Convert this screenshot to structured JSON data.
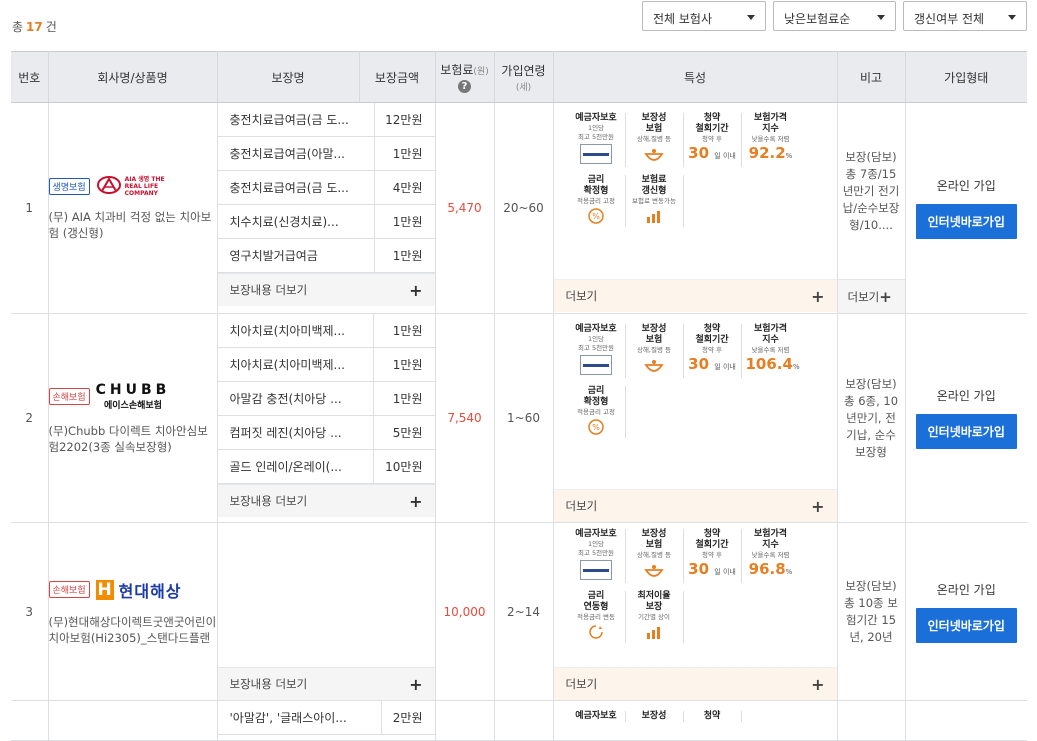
{
  "summary": {
    "prefix": "총",
    "count": "17",
    "suffix": "건"
  },
  "filters": [
    {
      "value": "전체 보험사"
    },
    {
      "value": "낮은보험료순"
    },
    {
      "value": "갱신여부 전체"
    }
  ],
  "headers": {
    "no": "번호",
    "company": "회사명/상품명",
    "coverage": "보장명",
    "amount": "보장금액",
    "premium": "보험료",
    "premium_unit": "(원)",
    "age": "가입연령",
    "age_unit": "(세)",
    "feature": "특성",
    "remark": "비고",
    "join": "가입형태"
  },
  "labels": {
    "coverage_more": "보장내용 더보기",
    "feature_more": "더보기",
    "remark_more": "더보기",
    "join_button": "인터넷바로가입",
    "help": "?"
  },
  "products": [
    {
      "no": "1",
      "type": "생명보험",
      "logo": "AIA 생명 THE REAL LIFE COMPANY",
      "name": "(무) AIA 치과비 걱정 없는 치아보험 (갱신형)",
      "coverages": [
        {
          "name": "충전치료급여금(금 도...",
          "amount": "12만원"
        },
        {
          "name": "충전치료급여금(아말...",
          "amount": "1만원"
        },
        {
          "name": "충전치료급여금(금 도...",
          "amount": "4만원"
        },
        {
          "name": "치수치료(신경치료)...",
          "amount": "1만원"
        },
        {
          "name": "영구치발거급여금",
          "amount": "1만원"
        }
      ],
      "premium": "5,470",
      "age": "20~60",
      "features": [
        {
          "t": "예금자보호",
          "s1": "1인당",
          "s2": "최고 5천만원",
          "icon": "seal"
        },
        {
          "t": "보장성\n보험",
          "s1": "상해,질병 등",
          "icon": "bowl"
        },
        {
          "t": "청약\n철회기간",
          "s1": "청약 후",
          "big": "30",
          "unit": "일 이내"
        },
        {
          "t": "보험가격\n지수",
          "s1": "낮을수록 저렴",
          "big": "92.2",
          "unit": "%"
        },
        {
          "t": "금리\n확정형",
          "s1": "적용금리 고정",
          "icon": "pct"
        },
        {
          "t": "보험료\n갱신형",
          "s1": "보험료 변동가능",
          "icon": "chart"
        }
      ],
      "remark": "보장(담보) 총 7종/15년만기 전기납/순수보장형/10....",
      "remark_more": true,
      "join_type": "온라인 가입"
    },
    {
      "no": "2",
      "type": "손해보험",
      "logo_big": "CHUBB",
      "logo_small": "에이스손해보험",
      "name": "(무)Chubb 다이렉트 치아안심보험2202(3종 실속보장형)",
      "coverages": [
        {
          "name": "치아치료(치아미백제...",
          "amount": "1만원"
        },
        {
          "name": "치아치료(치아미백제...",
          "amount": "1만원"
        },
        {
          "name": "아말감 충전(치아당 ...",
          "amount": "1만원"
        },
        {
          "name": "컴퍼짓 레진(치아당 ...",
          "amount": "5만원"
        },
        {
          "name": "골드 인레이/온레이(...",
          "amount": "10만원"
        }
      ],
      "premium": "7,540",
      "age": "1~60",
      "features": [
        {
          "t": "예금자보호",
          "s1": "1인당",
          "s2": "최고 5천만원",
          "icon": "seal"
        },
        {
          "t": "보장성\n보험",
          "s1": "상해,질병 등",
          "icon": "bowl"
        },
        {
          "t": "청약\n철회기간",
          "s1": "청약 후",
          "big": "30",
          "unit": "일 이내"
        },
        {
          "t": "보험가격\n지수",
          "s1": "낮을수록 저렴",
          "big": "106.4",
          "unit": "%"
        },
        {
          "t": "금리\n확정형",
          "s1": "적용금리 고정",
          "icon": "pct"
        }
      ],
      "remark": "보장(담보) 총 6종, 10년만기, 전기납, 순수보장형",
      "remark_more": false,
      "join_type": "온라인 가입"
    },
    {
      "no": "3",
      "type": "손해보험",
      "logo_mark": "H",
      "logo_name": "현대해상",
      "name": "(무)현대해상다이렉트굿앤굿어린이치아보험(Hi2305)_스탠다드플랜",
      "coverages": [],
      "premium": "10,000",
      "age": "2~14",
      "features": [
        {
          "t": "예금자보호",
          "s1": "1인당",
          "s2": "최고 5천만원",
          "icon": "seal"
        },
        {
          "t": "보장성\n보험",
          "s1": "상해,질병 등",
          "icon": "bowl"
        },
        {
          "t": "청약\n철회기간",
          "s1": "청약 후",
          "big": "30",
          "unit": "일 이내"
        },
        {
          "t": "보험가격\n지수",
          "s1": "낮을수록 저렴",
          "big": "96.8",
          "unit": "%"
        },
        {
          "t": "금리\n연동형",
          "s1": "적용금리 변동",
          "icon": "cycle"
        },
        {
          "t": "최저이율\n보장",
          "s1": "기간별 상이",
          "icon": "chart"
        }
      ],
      "remark": "보장(담보) 총 10종 보험기간 15년, 20년",
      "remark_more": false,
      "join_type": "온라인 가입"
    },
    {
      "partial": true,
      "coverages": [
        {
          "name": "'아말감', '글래스아이...",
          "amount": "2만원"
        }
      ],
      "features": [
        {
          "t": "예금자보호"
        },
        {
          "t": "보장성"
        },
        {
          "t": "청약"
        }
      ]
    }
  ]
}
